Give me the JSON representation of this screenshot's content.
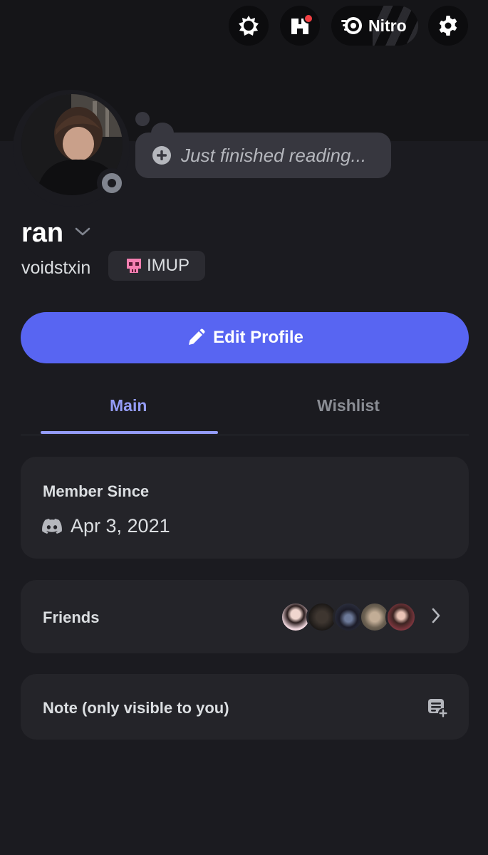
{
  "header": {
    "shop_icon": "shop-icon",
    "quests_icon": "quests-icon",
    "nitro_label": "Nitro",
    "settings_icon": "gear-icon",
    "notification_color": "#f23f43"
  },
  "profile": {
    "status_bubble": "Just finished reading...",
    "display_name": "ran",
    "username": "voidstxin",
    "tag": {
      "emoji": "💀",
      "text": "IMUP"
    },
    "edit_button": "Edit Profile",
    "accent_color": "#5865f2"
  },
  "tabs": [
    {
      "label": "Main",
      "active": true
    },
    {
      "label": "Wishlist",
      "active": false
    }
  ],
  "member_since": {
    "title": "Member Since",
    "date": "Apr 3, 2021"
  },
  "friends": {
    "title": "Friends"
  },
  "note": {
    "title": "Note (only visible to you)"
  }
}
